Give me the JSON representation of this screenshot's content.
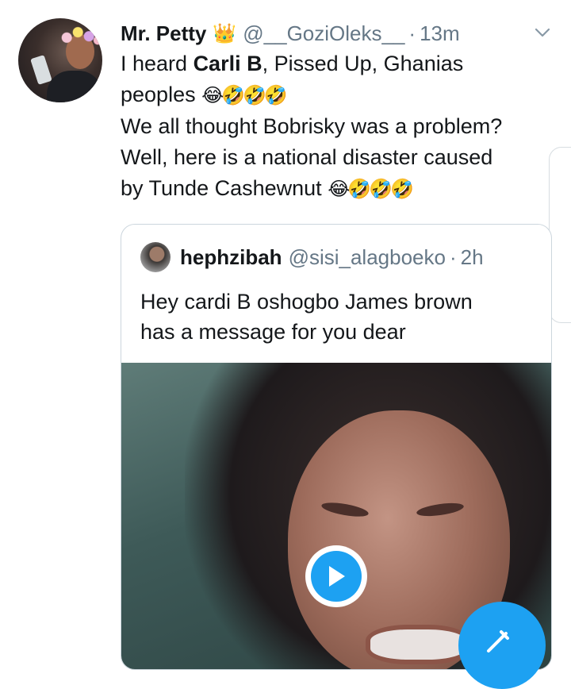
{
  "tweet": {
    "author_name": "Mr. Petty",
    "author_badge_icon": "crown-icon",
    "handle": "@__GoziOleks__",
    "separator": "·",
    "time": "13m",
    "lines": [
      {
        "before": "I heard ",
        "bold": "Carli B",
        "after": ", Pissed Up, Ghanias"
      },
      {
        "text": "peoples",
        "emoji": "😂🤣🤣🤣"
      },
      {
        "text": "We all thought Bobrisky was a problem?"
      },
      {
        "text": "Well, here is a national disaster caused"
      },
      {
        "text": "by Tunde Cashewnut",
        "emoji": "😂🤣🤣🤣"
      }
    ]
  },
  "quoted_tweet": {
    "author_name": "hephzibah",
    "handle": "@sisi_alagboeko",
    "separator": "·",
    "time": "2h",
    "lines": [
      "Hey cardi B oshogbo James brown",
      "has a message for you dear"
    ]
  },
  "media": {
    "type": "video",
    "play_icon": "play-icon"
  },
  "fab": {
    "icon": "compose-tweet-icon"
  },
  "colors": {
    "accent": "#1da1f2",
    "secondary_text": "#657786",
    "text": "#14171a",
    "border": "#ccd6dd"
  }
}
